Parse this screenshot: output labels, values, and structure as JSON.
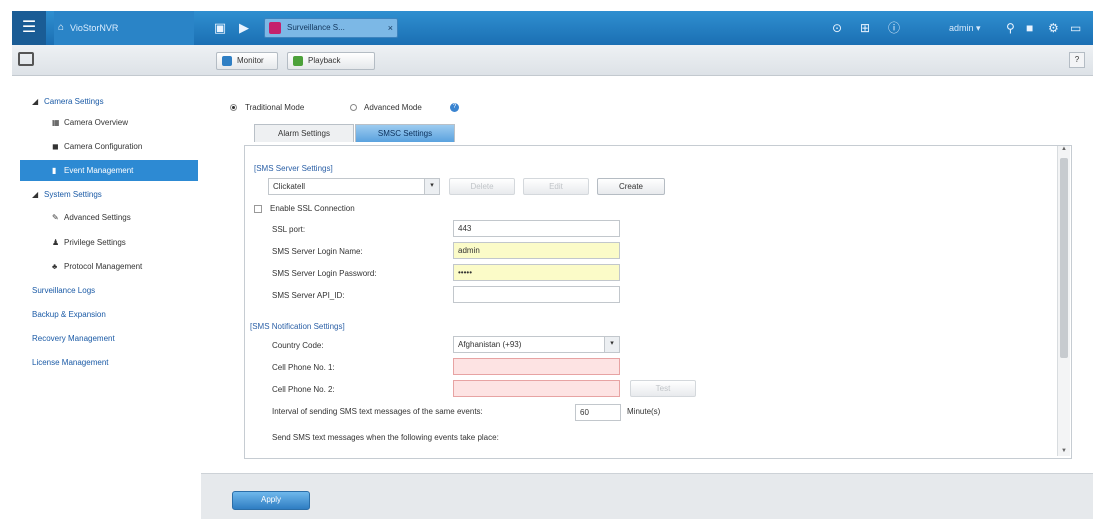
{
  "topbar": {
    "brand": "VioStorNVR",
    "tab_title": "Surveillance S...",
    "tab_close": "×",
    "user": "admin",
    "user_caret": "▾"
  },
  "subbar": {
    "monitor_label": "Monitor",
    "playback_label": "Playback",
    "help_label": "?"
  },
  "sidebar": {
    "camera_settings": "Camera Settings",
    "camera_overview": "Camera Overview",
    "camera_configuration": "Camera Configuration",
    "event_management": "Event Management",
    "system_settings": "System Settings",
    "advanced_settings": "Advanced Settings",
    "privilege_settings": "Privilege Settings",
    "protocol_management": "Protocol Management",
    "surveillance_logs": "Surveillance Logs",
    "backup_expansion": "Backup & Expansion",
    "recovery_management": "Recovery Management",
    "license_management": "License Management"
  },
  "mode": {
    "traditional": "Traditional Mode",
    "advanced": "Advanced Mode"
  },
  "tabs": {
    "alarm": "Alarm Settings",
    "smsc": "SMSC Settings"
  },
  "sms_server": {
    "section": "[SMS Server Settings]",
    "provider": "Clickatell",
    "delete_label": "Delete",
    "edit_label": "Edit",
    "create_label": "Create",
    "ssl_label": "Enable SSL Connection",
    "ssl_port_label": "SSL port:",
    "ssl_port_value": "443",
    "login_name_label": "SMS Server Login Name:",
    "login_name_value": "admin",
    "login_password_label": "SMS Server Login Password:",
    "login_password_value": "•••••",
    "api_id_label": "SMS Server API_ID:",
    "api_id_value": ""
  },
  "notification": {
    "section": "[SMS Notification Settings]",
    "country_label": "Country Code:",
    "country_value": "Afghanistan (+93)",
    "phone1_label": "Cell Phone No. 1:",
    "phone2_label": "Cell Phone No. 2:",
    "test_label": "Test",
    "interval_label": "Interval of sending SMS text messages of the same events:",
    "interval_value": "60",
    "interval_unit": "Minute(s)",
    "events_label": "Send SMS text messages when the following events take place:"
  },
  "footer": {
    "apply_label": "Apply"
  }
}
